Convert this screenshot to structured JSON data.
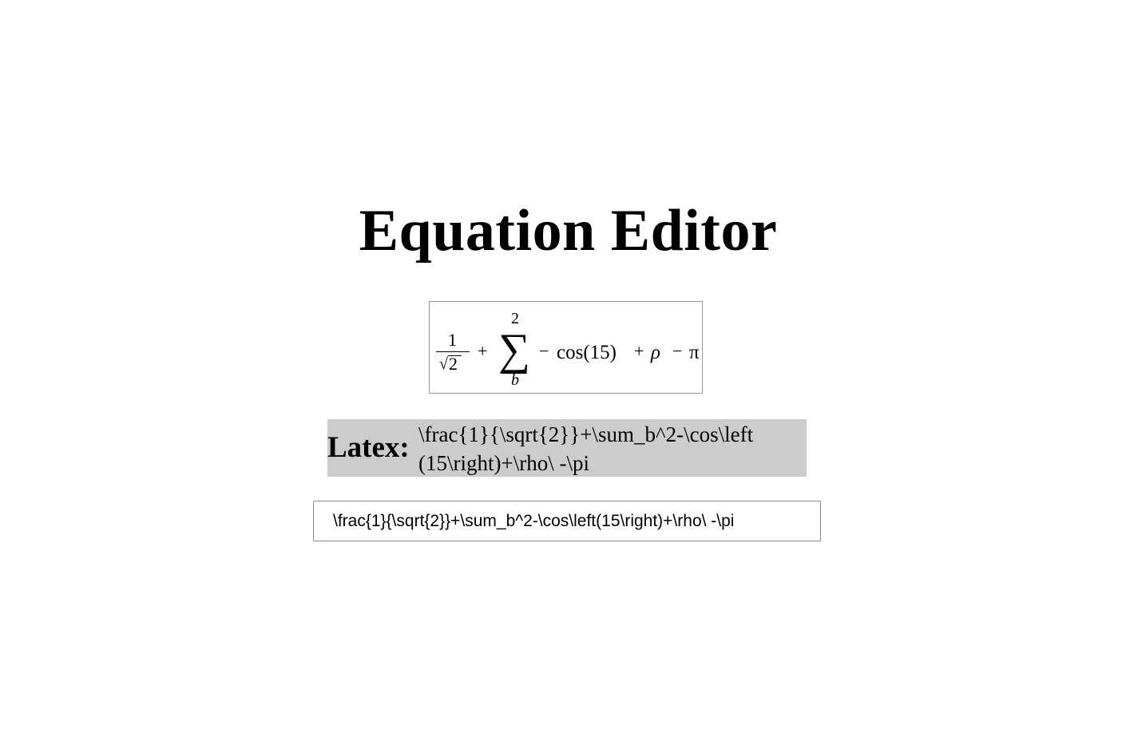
{
  "title": "Equation Editor",
  "rendered_equation": {
    "fraction_numerator": "1",
    "sqrt_symbol": "√",
    "sqrt_argument": "2",
    "plus_1": "+",
    "sum_symbol": "∑",
    "sum_upper_limit": "2",
    "sum_lower_limit": "b",
    "minus_1": "−",
    "cos_expression": "cos(15)",
    "plus_2": "+",
    "rho": "ρ",
    "minus_2": "−",
    "pi": "π"
  },
  "latex_display": {
    "label": "Latex:",
    "code": "\\frac{1}{\\sqrt{2}}+\\sum_b^2-\\cos\\left(15\\right)+\\rho\\ -\\pi"
  },
  "input": {
    "value": "\\frac{1}{\\sqrt{2}}+\\sum_b^2-\\cos\\left(15\\right)+\\rho\\ -\\pi"
  }
}
